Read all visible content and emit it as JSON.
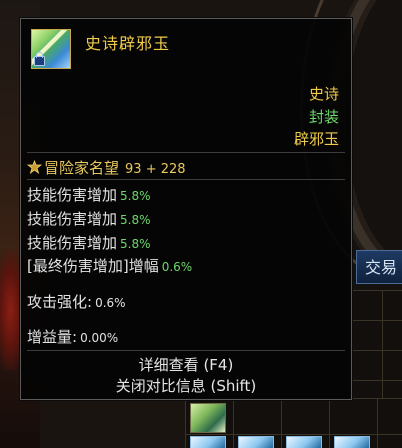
{
  "background": {
    "trade_tab_label": "交易"
  },
  "tooltip": {
    "item_icon": "jade-amulet-icon",
    "lock_icon": "lock-icon",
    "title": "史诗辟邪玉",
    "rarity": "史诗",
    "bind_status": "封装",
    "item_type": "辟邪玉",
    "fame": {
      "icon": "fame-emblem-icon",
      "label": "冒险家名望",
      "value": "93 + 228"
    },
    "stats": [
      {
        "label": "技能伤害增加",
        "value": "5.8%"
      },
      {
        "label": "技能伤害增加",
        "value": "5.8%"
      },
      {
        "label": "技能伤害增加",
        "value": "5.8%"
      },
      {
        "label": "[最终伤害增加]增幅",
        "value": "0.6%"
      },
      {
        "label": "攻击强化:",
        "value": "0.6%"
      },
      {
        "label": "增益量:",
        "value": "0.00%"
      }
    ],
    "detail_button": "详细查看 (F4)",
    "close_compare_button": "关闭对比信息 (Shift)"
  },
  "colors": {
    "gold": "#f0cb4a",
    "green": "#6fd86b",
    "panel": "#040404"
  }
}
